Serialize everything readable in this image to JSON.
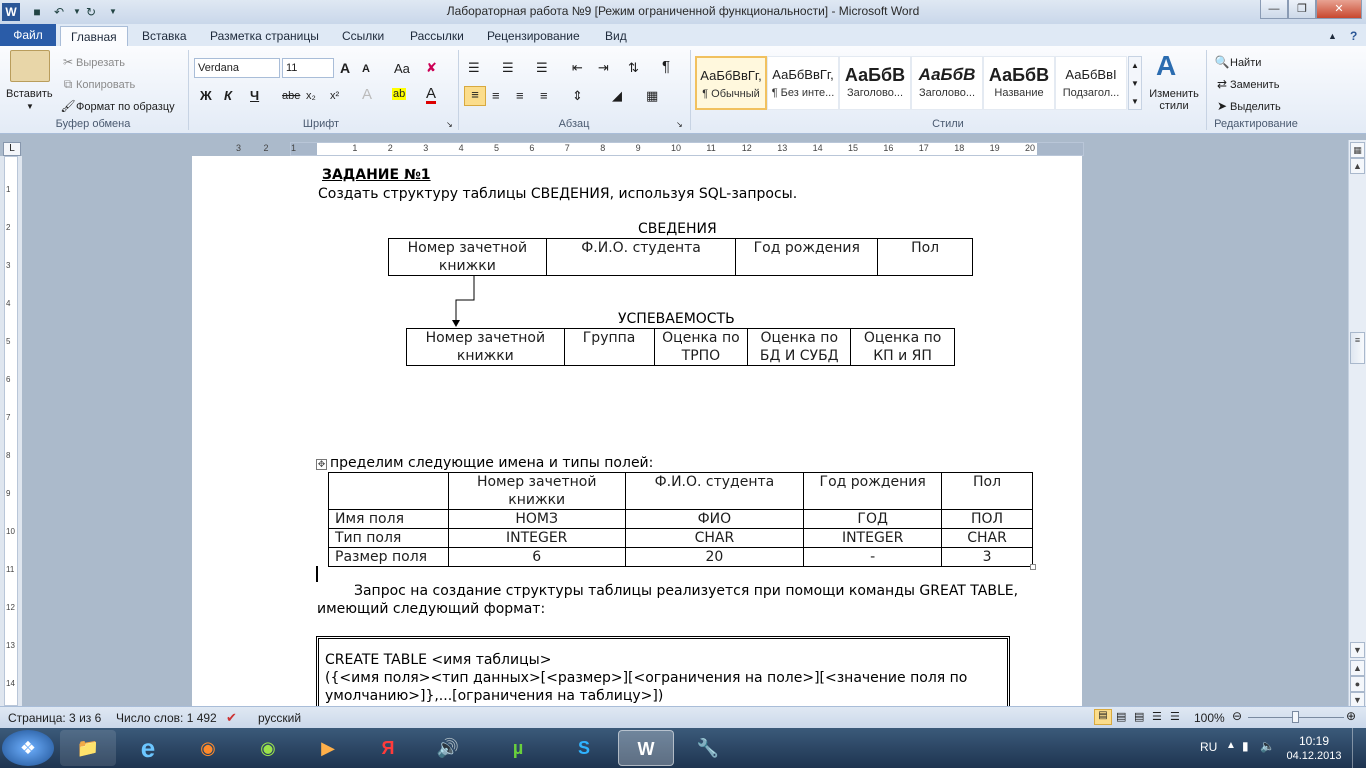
{
  "window": {
    "title": "Лабораторная работа №9 [Режим ограниченной функциональности] - Microsoft Word",
    "app_icon_letter": "W"
  },
  "tabs": {
    "file": "Файл",
    "items": [
      "Главная",
      "Вставка",
      "Разметка страницы",
      "Ссылки",
      "Рассылки",
      "Рецензирование",
      "Вид"
    ]
  },
  "ribbon": {
    "clipboard": {
      "paste": "Вставить",
      "cut": "Вырезать",
      "copy": "Копировать",
      "format_painter": "Формат по образцу",
      "label": "Буфер обмена"
    },
    "font": {
      "name": "Verdana",
      "size": "11",
      "label": "Шрифт",
      "bold": "Ж",
      "italic": "К",
      "underline": "Ч",
      "strike": "abe",
      "subscript": "x₂",
      "superscript": "x²",
      "grow": "A",
      "shrink": "A",
      "case": "Aa",
      "font_color": "A",
      "highlight": "ab"
    },
    "paragraph": {
      "label": "Абзац",
      "pilcrow": "¶"
    },
    "styles": {
      "label": "Стили",
      "items": [
        {
          "preview": "АаБбВвГг,",
          "name": "¶ Обычный"
        },
        {
          "preview": "АаБбВвГг,",
          "name": "¶ Без инте..."
        },
        {
          "preview": "АаБбВ",
          "name": "Заголово..."
        },
        {
          "preview": "АаБбВ",
          "name": "Заголово..."
        },
        {
          "preview": "АаБбВ",
          "name": "Название"
        },
        {
          "preview": "АаБбВвІ",
          "name": "Подзагол..."
        }
      ],
      "change_styles": "Изменить стили"
    },
    "editing": {
      "label": "Редактирование",
      "find": "Найти",
      "replace": "Заменить",
      "select": "Выделить"
    }
  },
  "ruler": {
    "ticks": [
      "3",
      "2",
      "1",
      "1",
      "2",
      "3",
      "4",
      "5",
      "6",
      "7",
      "8",
      "9",
      "10",
      "11",
      "12",
      "13",
      "14",
      "15",
      "16",
      "17",
      "18",
      "19",
      "20"
    ]
  },
  "vruler_ticks": [
    "1",
    "2",
    "3",
    "4",
    "5",
    "6",
    "7",
    "8",
    "9",
    "10",
    "11",
    "12",
    "13",
    "14"
  ],
  "document": {
    "heading": "ЗАДАНИЕ №1",
    "intro": "Создать структуру таблицы СВЕДЕНИЯ, используя SQL-запросы.",
    "table1_title": "СВЕДЕНИЯ",
    "table1": [
      [
        "Номер зачетной книжки",
        "Ф.И.О. студента",
        "Год рождения",
        "Пол"
      ]
    ],
    "table2_title": "УСПЕВАЕМОСТЬ",
    "table2": [
      [
        "Номер зачетной книжки",
        "Группа",
        "Оценка по ТРПО",
        "Оценка по БД И СУБД",
        "Оценка по КП и ЯП"
      ]
    ],
    "define_text": "пределим следующие имена и типы полей:",
    "table3_header": [
      "",
      "Номер зачетной книжки",
      "Ф.И.О. студента",
      "Год рождения",
      "Пол"
    ],
    "table3_rows": [
      [
        "Имя поля",
        "НОМЗ",
        "ФИО",
        "ГОД",
        "ПОЛ"
      ],
      [
        "Тип поля",
        "INTEGER",
        "CHAR",
        "INTEGER",
        "CHAR"
      ],
      [
        "Размер поля",
        "6",
        "20",
        "-",
        "3"
      ]
    ],
    "query_text_1": "Запрос на создание структуры таблицы реализуется при помощи команды GREAT TABLE,",
    "query_text_2": "имеющий следующий формат:",
    "code_line1": "CREATE TABLE <имя таблицы>",
    "code_line2": "({<имя поля><тип данных>[<размер>][<ограничения на поле>][<значение поля по",
    "code_line3": "умолчанию>]},...[ограничения на таблицу>])"
  },
  "status": {
    "page": "Страница: 3 из 6",
    "words": "Число слов: 1 492",
    "language": "русский",
    "zoom": "100%"
  },
  "taskbar": {
    "lang": "RU",
    "time": "10:19",
    "date": "04.12.2013"
  }
}
